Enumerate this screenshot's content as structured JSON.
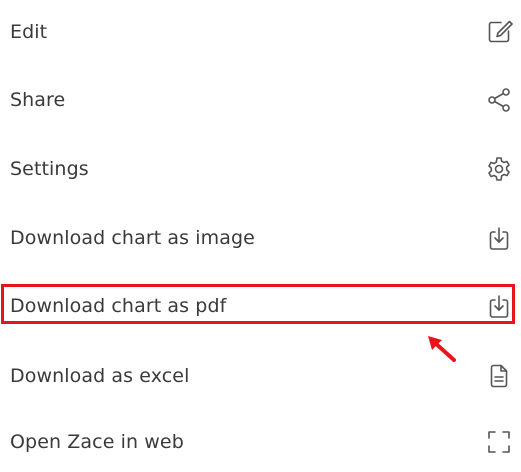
{
  "menu": {
    "items": [
      {
        "label": "Edit",
        "icon": "edit-icon"
      },
      {
        "label": "Share",
        "icon": "share-icon"
      },
      {
        "label": "Settings",
        "icon": "gear-icon"
      },
      {
        "label": "Download chart as image",
        "icon": "download-icon"
      },
      {
        "label": "Download chart as pdf",
        "icon": "download-icon"
      },
      {
        "label": "Download as excel",
        "icon": "document-icon"
      },
      {
        "label": "Open Zace in web",
        "icon": "expand-icon"
      }
    ]
  },
  "annotation": {
    "highlight_color": "#e8141c",
    "highlighted_item": "Download chart as pdf"
  },
  "colors": {
    "text": "#3a3a3a",
    "icon": "#555555",
    "background": "#ffffff"
  }
}
